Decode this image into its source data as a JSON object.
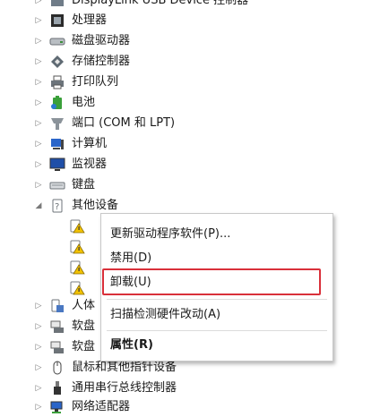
{
  "tree": {
    "clipped_top_label": "DisplayLink USB Device 控制器",
    "items": [
      {
        "label": "处理器",
        "icon": "processor-icon"
      },
      {
        "label": "磁盘驱动器",
        "icon": "disk-drive-icon"
      },
      {
        "label": "存储控制器",
        "icon": "storage-controller-icon"
      },
      {
        "label": "打印队列",
        "icon": "printer-icon"
      },
      {
        "label": "电池",
        "icon": "battery-icon"
      },
      {
        "label": "端口 (COM 和 LPT)",
        "icon": "port-icon"
      },
      {
        "label": "计算机",
        "icon": "computer-icon"
      },
      {
        "label": "监视器",
        "icon": "monitor-icon"
      },
      {
        "label": "键盘",
        "icon": "keyboard-icon"
      },
      {
        "label": "其他设备",
        "icon": "other-devices-icon"
      },
      {
        "label": "人体",
        "icon": "human-interface-icon"
      },
      {
        "label": "软盘",
        "icon": "floppy-controller-icon"
      },
      {
        "label": "软盘",
        "icon": "floppy-drive-icon"
      },
      {
        "label": "鼠标和其他指针设备",
        "icon": "mouse-icon"
      },
      {
        "label": "通用串行总线控制器",
        "icon": "usb-icon"
      },
      {
        "label": "网络适配器",
        "icon": "network-adapter-icon"
      }
    ],
    "children_other_devices": [
      {
        "label": "",
        "icon": "unknown-device-warning-icon"
      },
      {
        "label": "",
        "icon": "unknown-device-warning-icon"
      },
      {
        "label": "",
        "icon": "unknown-device-warning-icon"
      },
      {
        "label": "",
        "icon": "unknown-device-warning-icon"
      }
    ]
  },
  "context_menu": {
    "update_driver": "更新驱动程序软件(P)...",
    "disable": "禁用(D)",
    "uninstall": "卸载(U)",
    "scan": "扫描检测硬件改动(A)",
    "properties": "属性(R)"
  },
  "colors": {
    "highlight_border": "#d9303a",
    "warning": "#f2c200"
  }
}
